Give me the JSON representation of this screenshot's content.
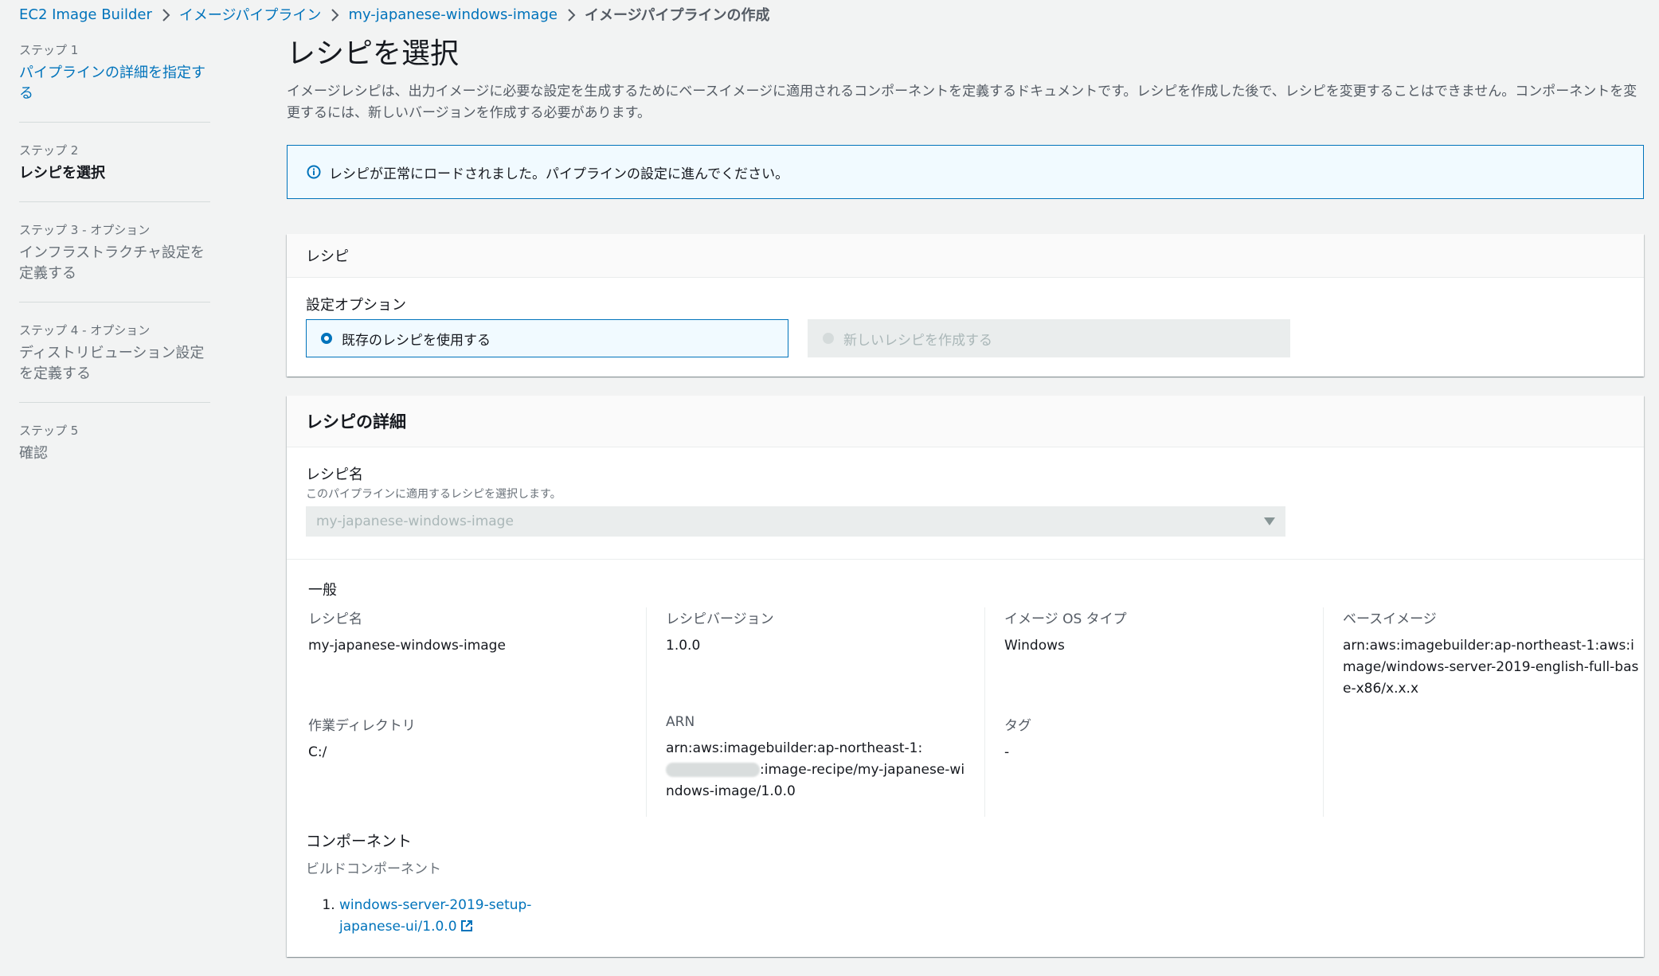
{
  "breadcrumb": [
    {
      "label": "EC2 Image Builder"
    },
    {
      "label": "イメージパイプライン"
    },
    {
      "label": "my-japanese-windows-image"
    },
    {
      "label": "イメージパイプラインの作成"
    }
  ],
  "steps": [
    {
      "num": "ステップ 1",
      "title": "パイプラインの詳細を指定する",
      "state": "link"
    },
    {
      "num": "ステップ 2",
      "title": "レシピを選択",
      "state": "active"
    },
    {
      "num": "ステップ 3 - オプション",
      "title": "インフラストラクチャ設定を定義する",
      "state": "disabled"
    },
    {
      "num": "ステップ 4 - オプション",
      "title": "ディストリビューション設定を定義する",
      "state": "disabled"
    },
    {
      "num": "ステップ 5",
      "title": "確認",
      "state": "disabled"
    }
  ],
  "page": {
    "title": "レシピを選択",
    "description": "イメージレシピは、出力イメージに必要な設定を生成するためにベースイメージに適用されるコンポーネントを定義するドキュメントです。レシピを作成した後で、レシピを変更することはできません。コンポーネントを変更するには、新しいバージョンを作成する必要があります。"
  },
  "flash": {
    "message": "レシピが正常にロードされました。パイプラインの設定に進んでください。",
    "icon": "info-icon"
  },
  "recipe_panel": {
    "header": "レシピ",
    "option_label": "設定オプション",
    "option_existing": "既存のレシピを使用する",
    "option_new": "新しいレシピを作成する"
  },
  "details_panel": {
    "header": "レシピの詳細",
    "recipe_name_label": "レシピ名",
    "recipe_name_desc": "このパイプラインに適用するレシピを選択します。",
    "recipe_name_value": "my-japanese-windows-image",
    "general_title": "一般",
    "general": {
      "recipe_name_key": "レシピ名",
      "recipe_name_val": "my-japanese-windows-image",
      "version_key": "レシピバージョン",
      "version_val": "1.0.0",
      "os_key": "イメージ OS タイプ",
      "os_val": "Windows",
      "base_key": "ベースイメージ",
      "base_val": "arn:aws:imagebuilder:ap-northeast-1:aws:image/windows-server-2019-english-full-base-x86/x.x.x",
      "workdir_key": "作業ディレクトリ",
      "workdir_val": "C:/",
      "arn_key": "ARN",
      "arn_prefix": "arn:aws:imagebuilder:ap-northeast-1:",
      "arn_suffix": ":image-recipe/my-japanese-windows-image/1.0.0",
      "tags_key": "タグ",
      "tags_val": "-"
    },
    "components_title": "コンポーネント",
    "build_components_label": "ビルドコンポーネント",
    "components": [
      {
        "label": "windows-server-2019-setup-japanese-ui/1.0.0",
        "icon": "external-link-icon"
      }
    ]
  },
  "colors": {
    "link": "#0073bb",
    "background": "#f2f3f3",
    "info_border": "#0073bb",
    "info_bg": "#f1faff"
  }
}
